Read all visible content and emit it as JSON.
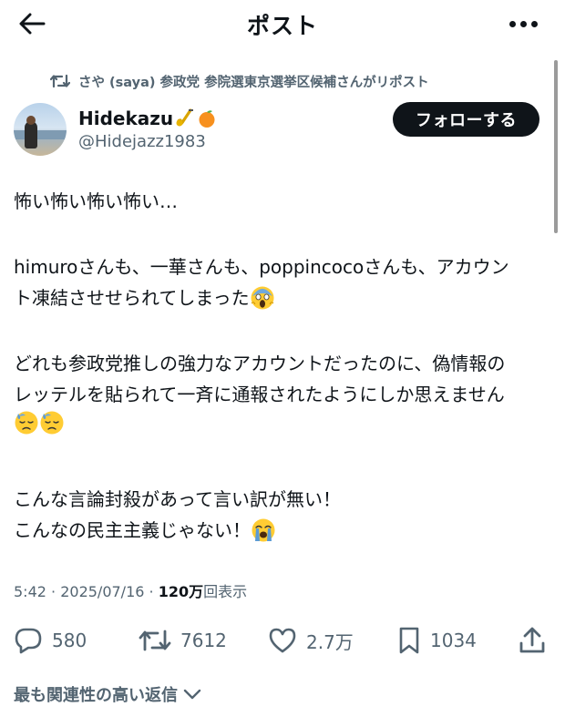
{
  "header": {
    "title": "ポスト",
    "back_icon": "arrow-left-icon",
    "more_icon": "more-dots-icon"
  },
  "repost": {
    "icon": "repost-icon",
    "text": "さや (saya) 参政党 参院選東京選挙区候補さんがリポスト"
  },
  "author": {
    "display_name": "Hidekazu",
    "name_emojis": [
      "saxophone-emoji",
      "orange-emoji"
    ],
    "handle": "@Hidejazz1983",
    "follow_label": "フォローする"
  },
  "post": {
    "lines": [
      "怖い怖い怖い怖い…",
      "himuroさんも、一華さんも、poppincocoさんも、アカウン",
      "ト凍結させせられてしまった",
      "どれも参政党推しの強力なアカウントだったのに、偽情報の",
      "レッテルを貼られて一斉に通報されたようにしか思えません",
      "こんな言論封殺があって言い訳が無い！",
      "こんなの民主主義じゃない！"
    ],
    "emojis": {
      "scream": "face-screaming-emoji",
      "sweat": "downcast-sweat-emoji",
      "crying": "loudly-crying-emoji"
    }
  },
  "meta": {
    "time": "5:42",
    "sep1": " · ",
    "date": "2025/07/16",
    "sep2": " · ",
    "views": "120万",
    "views_label": "回表示"
  },
  "actions": {
    "replies": "580",
    "reposts": "7612",
    "likes": "2.7万",
    "bookmarks": "1034"
  },
  "sort": {
    "label": "最も関連性の高い返信"
  },
  "colors": {
    "text": "#0f1419",
    "secondary": "#536471",
    "button_bg": "#0f1419"
  }
}
